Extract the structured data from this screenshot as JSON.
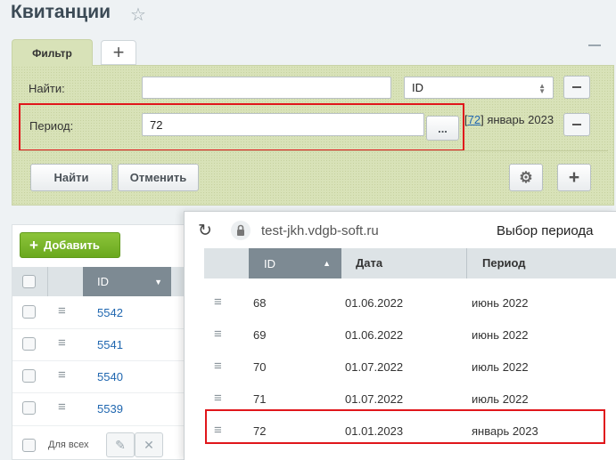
{
  "page": {
    "title": "Квитанции"
  },
  "filter": {
    "tab_label": "Фильтр",
    "find_label": "Найти:",
    "find_value": "",
    "field_select_value": "ID",
    "period_label": "Период:",
    "period_value": "72",
    "browse_label": "...",
    "period_link_text": "72",
    "period_display_text": "январь 2023",
    "find_button": "Найти",
    "cancel_button": "Отменить"
  },
  "list": {
    "add_button": "Добавить",
    "id_column": "ID",
    "rows": [
      {
        "id": "5542"
      },
      {
        "id": "5541"
      },
      {
        "id": "5540"
      },
      {
        "id": "5539"
      }
    ],
    "footer_label": "Для всех"
  },
  "popup": {
    "url": "test-jkh.vdgb-soft.ru",
    "title": "Выбор периода",
    "columns": [
      "ID",
      "Дата",
      "Период"
    ],
    "rows": [
      {
        "id": "68",
        "date": "01.06.2022",
        "period": "июнь 2022"
      },
      {
        "id": "69",
        "date": "01.06.2022",
        "period": "июнь 2022"
      },
      {
        "id": "70",
        "date": "01.07.2022",
        "period": "июль 2022"
      },
      {
        "id": "71",
        "date": "01.07.2022",
        "period": "июль 2022"
      },
      {
        "id": "72",
        "date": "01.01.2023",
        "period": "январь 2023"
      }
    ]
  },
  "colors": {
    "filter_bg": "#d8e2b8",
    "accent_green": "#6aa81e",
    "highlight_red": "#e0161b",
    "link_blue": "#2067b0",
    "header_sorted": "#7d8a93"
  }
}
